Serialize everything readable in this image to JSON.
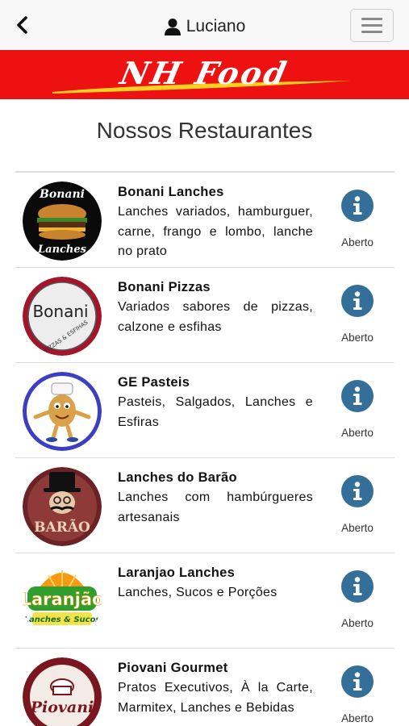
{
  "header": {
    "user_name": "Luciano"
  },
  "banner": {
    "logo_text": "NH Food"
  },
  "page_title": "Nossos Restaurantes",
  "colors": {
    "banner_red": "#ee1111",
    "info_blue": "#336f99",
    "topbar_bg": "#f8f8f8"
  },
  "restaurants": [
    {
      "name": "Bonani Lanches",
      "description": "Lanches variados, hamburguer, carne, frango e lombo, lanche no prato",
      "status": "Aberto",
      "logo_lines": [
        "Bonani",
        "Lanches"
      ]
    },
    {
      "name": "Bonani Pizzas",
      "description": "Variados sabores de pizzas, calzone e esfihas",
      "status": "Aberto",
      "logo_lines": [
        "Bonani",
        "PIZZAS & ESFIHAS"
      ]
    },
    {
      "name": "GE Pasteis",
      "description": "Pasteis, Salgados, Lanches e Esfiras",
      "status": "Aberto",
      "logo_lines": []
    },
    {
      "name": "Lanches do Barão",
      "description": "Lanches com hambúrgueres artesanais",
      "status": "Aberto",
      "logo_lines": [
        "BARÃO"
      ]
    },
    {
      "name": "Laranjao Lanches",
      "description": "Lanches, Sucos e Porções",
      "status": "Aberto",
      "logo_lines": [
        "Laranjão",
        "Lanches & Sucos"
      ]
    },
    {
      "name": "Piovani Gourmet",
      "description": "Pratos Executivos, À la Carte, Marmitex, Lanches e Bebidas",
      "status": "Aberto",
      "logo_lines": [
        "Piovani"
      ]
    }
  ]
}
